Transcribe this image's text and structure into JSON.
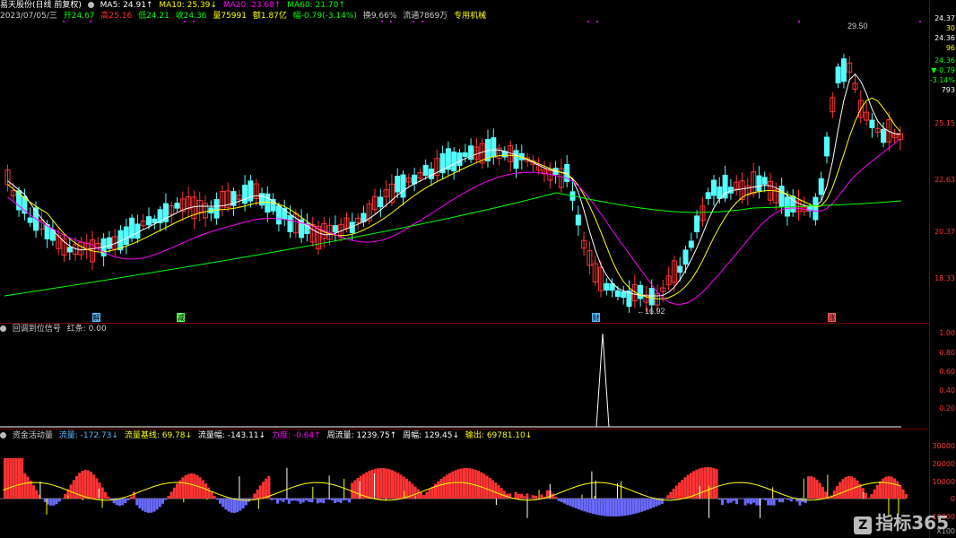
{
  "header": {
    "title": "易天股份(日线 前复权)",
    "ma5": "MA5: 24.91↑",
    "ma10": "MA10: 25.39↓",
    "ma20": "MA20: 23.68↑",
    "ma60": "MA60: 21.70↑",
    "info_date": "2023/07/05/三",
    "open": "开24.67",
    "high": "高25.16",
    "low": "低24.21",
    "close": "收24.36",
    "volume": "量75991",
    "amount": "额1.87亿",
    "change": "幅-0.79(-3.14%)",
    "turnover": "换9.66%",
    "float": "流通7869万",
    "sector": "专用机械"
  },
  "price_axis": [
    "24.37",
    "30",
    "24.36",
    "96",
    "24.36",
    "▼-0.79",
    "-3.14%",
    "793",
    "25.15",
    "22.63",
    "20.37",
    "18.33"
  ],
  "annotations": {
    "high": "29.50",
    "low": "←16.92"
  },
  "markers": [
    "解",
    "减",
    "财",
    "涨"
  ],
  "panel2": {
    "title": "回调到位信号",
    "value": "红条: 0.00",
    "axis": [
      "1.00",
      "0.80",
      "0.60",
      "0.40",
      "0.20"
    ]
  },
  "panel3": {
    "title": "资金活动量",
    "items": [
      "流量: -172.73↓",
      "流量基线: 69.78↓",
      "流量幅: -143.11↓",
      "力度: -0.64↑",
      "周流量: 1239.75↑",
      "周幅: 129.45↓",
      "输出: 69781.10↓"
    ],
    "axis": [
      "30000",
      "20000",
      "10000",
      "0",
      "-10000"
    ],
    "scale": "X100"
  },
  "watermark": "指标365",
  "colors": {
    "up": "#ff3333",
    "down": "#54ffff",
    "ma5": "#ffffff",
    "ma10": "#ffff00",
    "ma20": "#ff00ff",
    "ma60": "#00ff00"
  }
}
